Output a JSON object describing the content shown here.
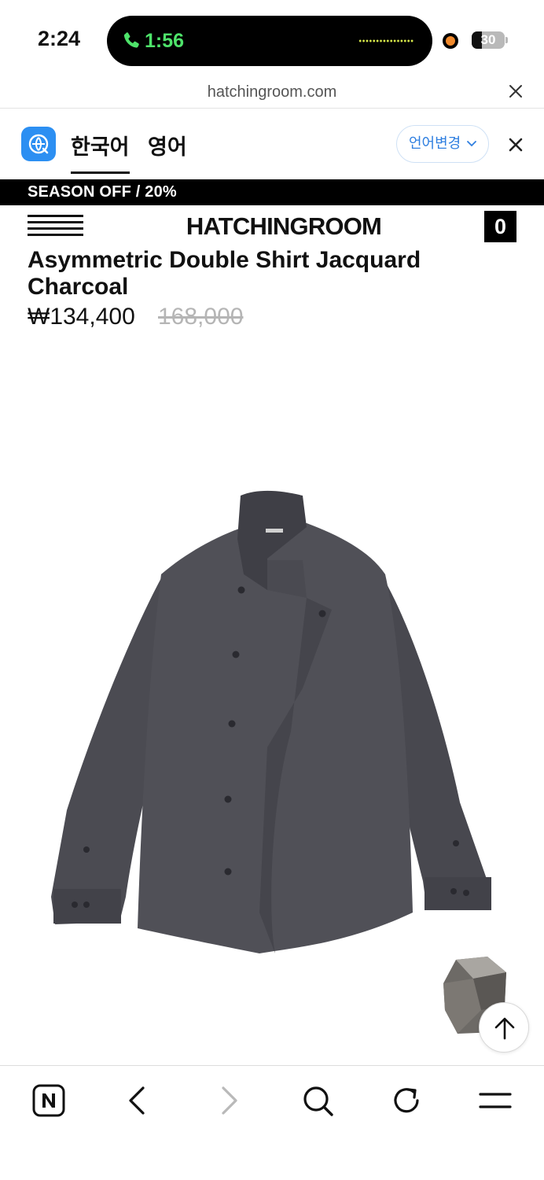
{
  "status_bar": {
    "time": "2:24",
    "call_duration": "1:56",
    "battery_level": "30",
    "battery_fraction": 0.3,
    "call_color": "#4ee36a"
  },
  "browser": {
    "url": "hatchingroom.com"
  },
  "translate_bar": {
    "tabs": [
      "한국어",
      "영어"
    ],
    "active_tab": "한국어",
    "change_language_label": "언어변경",
    "logo_color": "#2c8ff2"
  },
  "promo": {
    "text": "SEASON OFF / 20%"
  },
  "header": {
    "brand": "HATCHINGROOM",
    "cart_count": "0"
  },
  "product": {
    "title": "Asymmetric Double Shirt Jacquard Charcoal",
    "price": "₩134,400",
    "original_price": "168,000",
    "image_icon": "charcoal-shirt-photo"
  },
  "toolbar": {
    "items": [
      "naver-icon",
      "back-icon",
      "forward-icon",
      "search-icon",
      "refresh-icon",
      "menu-icon"
    ]
  }
}
